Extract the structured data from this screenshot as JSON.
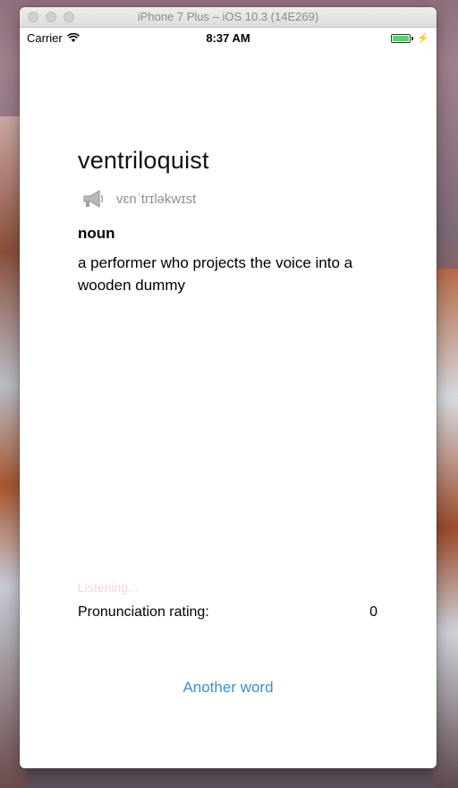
{
  "window": {
    "title": "iPhone 7 Plus – iOS 10.3 (14E269)"
  },
  "status_bar": {
    "carrier": "Carrier",
    "time": "8:37 AM"
  },
  "entry": {
    "word": "ventriloquist",
    "ipa": "vɛnˈtrɪləkwɪst",
    "part_of_speech": "noun",
    "definition": "a performer who projects the voice into a wooden dummy"
  },
  "listening_label": "Listening...",
  "rating": {
    "label": "Pronunciation rating:",
    "value": "0"
  },
  "another_word_label": "Another word",
  "colors": {
    "link": "#3a8fd6",
    "battery": "#4cd964",
    "listening": "#f0d9cf"
  }
}
